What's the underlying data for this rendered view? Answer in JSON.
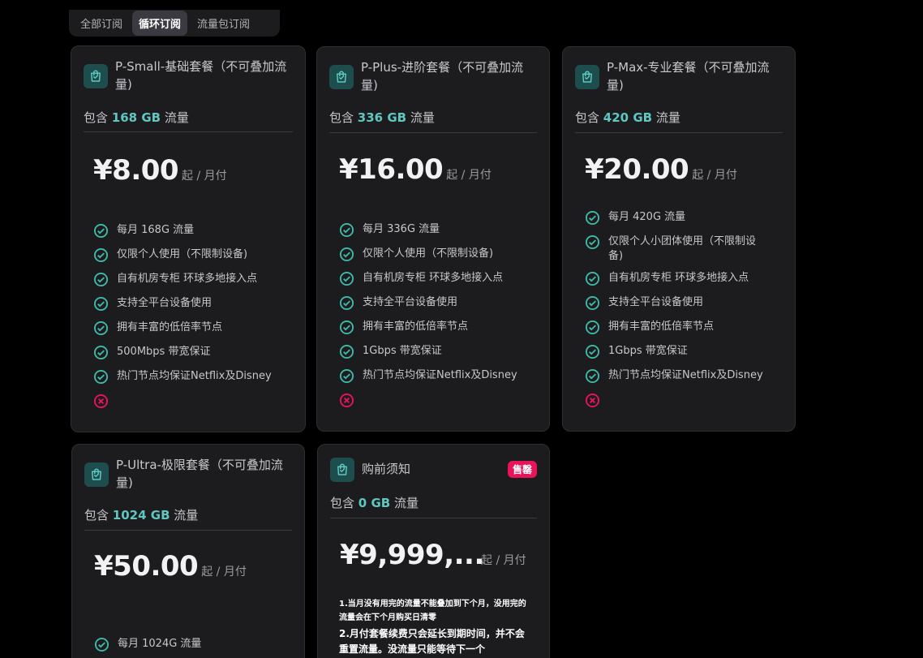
{
  "tabs": [
    {
      "label": "全部订阅",
      "active": false
    },
    {
      "label": "循环订阅",
      "active": true
    },
    {
      "label": "流量包订阅",
      "active": false
    }
  ],
  "colors": {
    "accent": "#5ec7c0",
    "check": "#3fb8a8",
    "cross": "#e8145a",
    "badge": "#e8145a",
    "card": "#1c1c1f"
  },
  "cards": [
    {
      "title": "P-Small-基础套餐（不可叠加流量)",
      "traffic_prefix": "包含",
      "traffic_amount": "168 GB",
      "traffic_suffix": "流量",
      "price": "¥8.00",
      "period": "起 / 月付",
      "features": [
        "每月 168G 流量",
        "仅限个人使用（不限制设备)",
        "自有机房专柜 环球多地接入点",
        "支持全平台设备使用",
        "拥有丰富的低倍率节点",
        "500Mbps 带宽保证",
        "热门节点均保证Netflix及Disney",
        ""
      ]
    },
    {
      "title": "P-Plus-进阶套餐（不可叠加流量)",
      "traffic_prefix": "包含",
      "traffic_amount": "336 GB",
      "traffic_suffix": "流量",
      "price": "¥16.00",
      "period": "起 / 月付",
      "features": [
        "每月 336G 流量",
        "仅限个人使用（不限制设备)",
        "自有机房专柜 环球多地接入点",
        "支持全平台设备使用",
        "拥有丰富的低倍率节点",
        "1Gbps 带宽保证",
        "热门节点均保证Netflix及Disney",
        ""
      ]
    },
    {
      "title": "P-Max-专业套餐（不可叠加流量)",
      "traffic_prefix": "包含",
      "traffic_amount": "420 GB",
      "traffic_suffix": "流量",
      "price": "¥20.00",
      "period": "起 / 月付",
      "features": [
        "每月 420G 流量",
        "仅限个人小团体使用（不限制设备)",
        "自有机房专柜 环球多地接入点",
        "支持全平台设备使用",
        "拥有丰富的低倍率节点",
        "1Gbps 带宽保证",
        "热门节点均保证Netflix及Disney",
        ""
      ]
    },
    {
      "title": "P-Ultra-极限套餐（不可叠加流量)",
      "traffic_prefix": "包含",
      "traffic_amount": "1024 GB",
      "traffic_suffix": "流量",
      "price": "¥50.00",
      "period": "起 / 月付",
      "features": [
        "每月 1024G 流量"
      ]
    },
    {
      "title": "购前须知",
      "badge": "售罄",
      "traffic_prefix": "包含",
      "traffic_amount": "0 GB",
      "traffic_suffix": "流量",
      "price": "¥9,999,...",
      "period": "起 / 月付",
      "notice": [
        "1.当月没有用完的流量不能叠加到下个月，没用完的流量会在下个月购买日清零",
        "2.月付套餐续费只会延长到期时间，并不会重置流量。没流量只能等待下一个"
      ]
    }
  ]
}
